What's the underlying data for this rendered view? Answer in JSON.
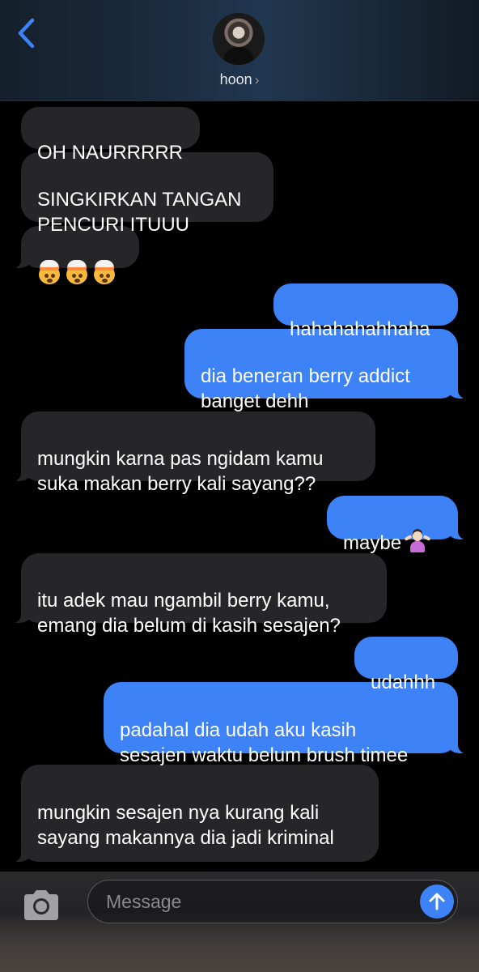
{
  "header": {
    "contact_name": "hoon",
    "chevron": "›",
    "back_icon": "chevron-left-icon",
    "accent": "#3d82f7"
  },
  "messages": [
    {
      "dir": "in",
      "text": "OH NAURRRRR"
    },
    {
      "dir": "in",
      "text": "SINGKIRKAN TANGAN\nPENCURI ITUUU"
    },
    {
      "dir": "in",
      "emoji": [
        "exploding-head-icon",
        "exploding-head-icon",
        "exploding-head-icon"
      ]
    },
    {
      "dir": "out",
      "text": "hahahahahhaha"
    },
    {
      "dir": "out",
      "text": "dia beneran berry addict\nbanget dehh"
    },
    {
      "dir": "in",
      "text": "mungkin karna pas ngidam kamu\nsuka makan berry kali sayang??"
    },
    {
      "dir": "out",
      "text": "maybe",
      "emoji": "woman-shrugging-icon"
    },
    {
      "dir": "in",
      "text": "itu adek mau ngambil berry kamu,\nemang dia belum di kasih sesajen?"
    },
    {
      "dir": "out",
      "text": "udahhh"
    },
    {
      "dir": "out",
      "text": "padahal dia udah aku kasih\nsesajen waktu belum brush timee"
    },
    {
      "dir": "in",
      "text": "mungkin sesajen nya kurang kali\nsayang makannya dia jadi kriminal"
    }
  ],
  "composer": {
    "placeholder": "Message",
    "value": "",
    "camera_icon": "camera-icon",
    "send_icon": "arrow-up-icon"
  },
  "colors": {
    "incoming_bubble": "#262629",
    "outgoing_bubble": "#3d82f7",
    "background": "#000000"
  }
}
